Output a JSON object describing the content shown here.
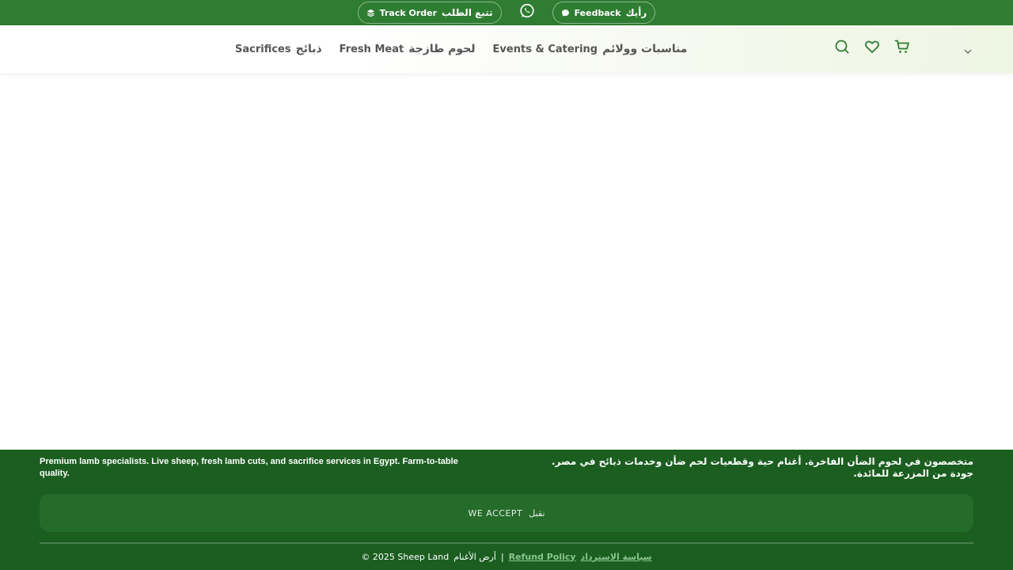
{
  "topbar": {
    "track_order": {
      "en": "Track Order",
      "ar": "تتبع الطلب",
      "icon": "layers-icon"
    },
    "whatsapp": {
      "icon": "whatsapp-icon"
    },
    "feedback": {
      "en": "Feedback",
      "ar": "رأيك",
      "icon": "chat-bubble-icon"
    }
  },
  "nav": {
    "items": [
      {
        "en": "Sacrifices",
        "ar": "ذبائح"
      },
      {
        "en": "Fresh Meat",
        "ar": "لحوم طازجة"
      },
      {
        "en": "Events & Catering",
        "ar": "مناسبات وولائم"
      }
    ]
  },
  "header_icons": [
    "search-icon",
    "heart-icon",
    "cart-icon"
  ],
  "footer": {
    "description_en": "Premium lamb specialists. Live sheep, fresh lamb cuts, and sacrifice services in Egypt. Farm-to-table quality.",
    "description_ar": "متخصصون في لحوم الضأن الفاخرة. أغنام حية وقطعيات لحم ضأن وخدمات ذبائح في مصر. جودة من المزرعة للمائدة.",
    "we_accept_en": "WE ACCEPT",
    "we_accept_ar": "نقبل",
    "copyright": "© 2025 Sheep Land",
    "copyright_sep": "|",
    "copyright_ar": "أرض الأغنام",
    "refund_en": "Refund Policy",
    "refund_ar": "سياسة الاسترداد"
  },
  "colors": {
    "topbar": "#2e7d32",
    "footer": "#1b5e20",
    "accent": "#2e7d32",
    "link": "#8bc48f"
  }
}
